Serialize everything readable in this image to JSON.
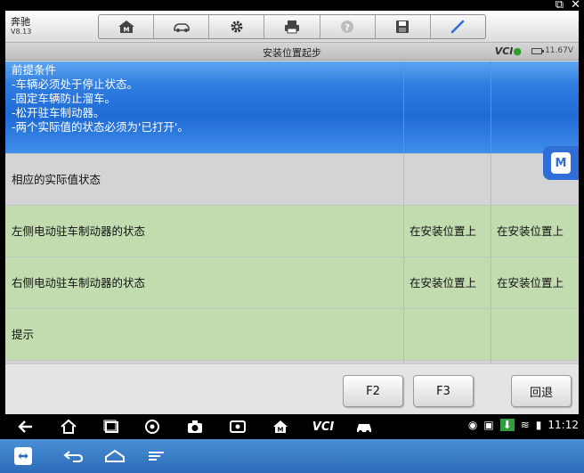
{
  "app": {
    "brand_name": "奔驰",
    "version": "V8.13"
  },
  "toolbar": {
    "icons": [
      "home-icon",
      "vehicle-icon",
      "settings-icon",
      "print-icon",
      "help-icon",
      "save-icon",
      "edit-icon"
    ]
  },
  "titlebar": {
    "title": "安装位置起步",
    "vci": "VCI",
    "battery": "11.67V"
  },
  "table": {
    "rows": [
      {
        "lines": [
          "前提条件",
          "-车辆必须处于停止状态。",
          "-固定车辆防止溜车。",
          "-松开驻车制动器。",
          "-两个实际值的状态必须为'已打开'。"
        ],
        "v1": "",
        "v2": "",
        "style": "selected"
      },
      {
        "label": "相应的实际值状态",
        "v1": "",
        "v2": "",
        "style": "header"
      },
      {
        "label": "左侧电动驻车制动器的状态",
        "v1": "在安装位置上",
        "v2": "在安装位置上",
        "style": "data"
      },
      {
        "label": "右侧电动驻车制动器的状态",
        "v1": "在安装位置上",
        "v2": "在安装位置上",
        "style": "data"
      },
      {
        "label": "提示",
        "v1": "",
        "v2": "",
        "style": "data"
      }
    ]
  },
  "fkeys": {
    "f2": "F2",
    "f3": "F3",
    "back": "回退"
  },
  "navbar": {
    "vci": "VCI",
    "time": "11:12"
  },
  "colors": {
    "selected_row": "#2f7de0",
    "green_row": "#c2dcb0",
    "grey_row": "#d4d4d4",
    "accent": "#2e6ed6"
  }
}
